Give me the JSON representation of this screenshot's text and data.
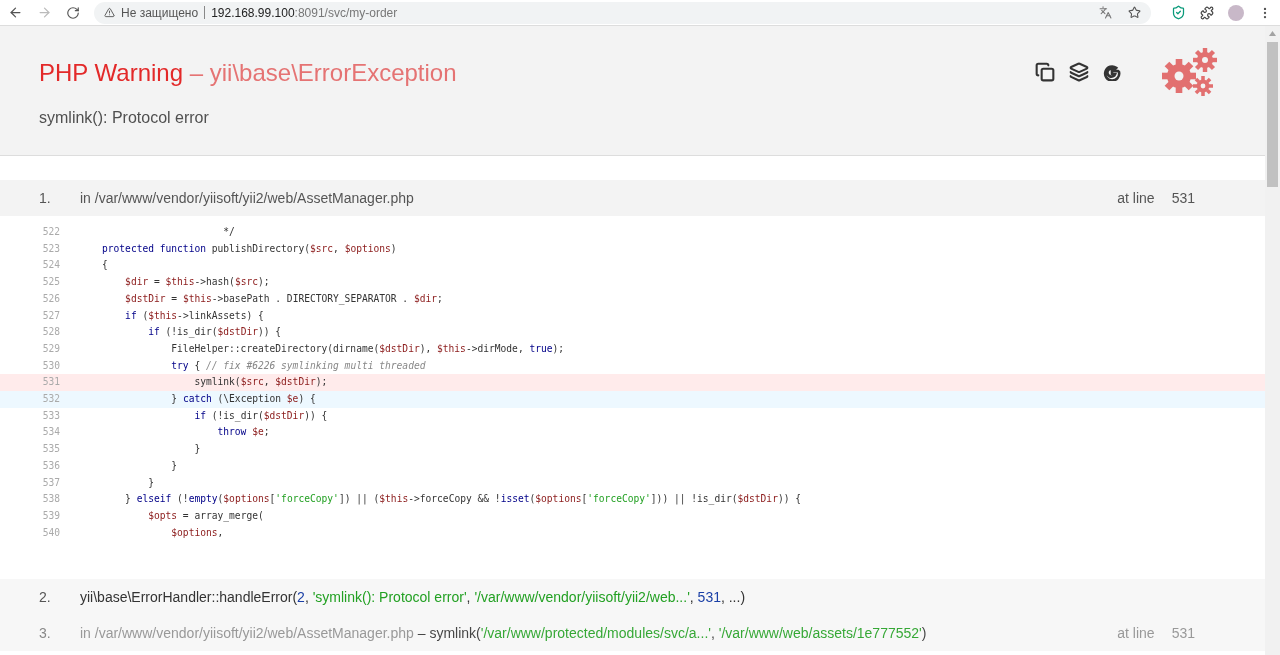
{
  "browser": {
    "security_label": "Не защищено",
    "url_host": "192.168.99.100",
    "url_rest": ":8091/svc/my-order",
    "forward_disabled": true
  },
  "error": {
    "type": "PHP Warning",
    "separator": " – ",
    "class": "yii\\base\\ErrorException",
    "message": "symlink(): Protocol error"
  },
  "frames": [
    {
      "number": "1.",
      "kind": "file",
      "file": "in /var/www/vendor/yiisoft/yii2/web/AssetManager.php",
      "at_line_label": "at line",
      "line": "531",
      "dimmed": false,
      "code": [
        {
          "number": "522",
          "kind": "normal",
          "tokens": [
            {
              "kind": "plain",
              "text": "                     */"
            }
          ]
        },
        {
          "number": "523",
          "kind": "normal",
          "tokens": [
            {
              "kind": "keyword",
              "text": "protected function "
            },
            {
              "kind": "plain",
              "text": "publishDirectory("
            },
            {
              "kind": "variable",
              "text": "$src"
            },
            {
              "kind": "plain",
              "text": ", "
            },
            {
              "kind": "variable",
              "text": "$options"
            },
            {
              "kind": "plain",
              "text": ")"
            }
          ]
        },
        {
          "number": "524",
          "kind": "normal",
          "tokens": [
            {
              "kind": "plain",
              "text": "{"
            }
          ]
        },
        {
          "number": "525",
          "kind": "normal",
          "tokens": [
            {
              "kind": "variable",
              "text": "    $dir"
            },
            {
              "kind": "plain",
              "text": " = "
            },
            {
              "kind": "variable",
              "text": "$this"
            },
            {
              "kind": "plain",
              "text": "->hash("
            },
            {
              "kind": "variable",
              "text": "$src"
            },
            {
              "kind": "plain",
              "text": ");"
            }
          ]
        },
        {
          "number": "526",
          "kind": "normal",
          "tokens": [
            {
              "kind": "variable",
              "text": "    $dstDir"
            },
            {
              "kind": "plain",
              "text": " = "
            },
            {
              "kind": "variable",
              "text": "$this"
            },
            {
              "kind": "plain",
              "text": "->basePath . DIRECTORY_SEPARATOR . "
            },
            {
              "kind": "variable",
              "text": "$dir"
            },
            {
              "kind": "plain",
              "text": ";"
            }
          ]
        },
        {
          "number": "527",
          "kind": "normal",
          "tokens": [
            {
              "kind": "keyword",
              "text": "    if "
            },
            {
              "kind": "plain",
              "text": "("
            },
            {
              "kind": "variable",
              "text": "$this"
            },
            {
              "kind": "plain",
              "text": "->linkAssets) {"
            }
          ]
        },
        {
          "number": "528",
          "kind": "normal",
          "tokens": [
            {
              "kind": "keyword",
              "text": "        if "
            },
            {
              "kind": "plain",
              "text": "(!is_dir("
            },
            {
              "kind": "variable",
              "text": "$dstDir"
            },
            {
              "kind": "plain",
              "text": ")) {"
            }
          ]
        },
        {
          "number": "529",
          "kind": "normal",
          "tokens": [
            {
              "kind": "plain",
              "text": "            FileHelper::createDirectory(dirname("
            },
            {
              "kind": "variable",
              "text": "$dstDir"
            },
            {
              "kind": "plain",
              "text": "), "
            },
            {
              "kind": "variable",
              "text": "$this"
            },
            {
              "kind": "plain",
              "text": "->dirMode, "
            },
            {
              "kind": "keyword",
              "text": "true"
            },
            {
              "kind": "plain",
              "text": ");"
            }
          ]
        },
        {
          "number": "530",
          "kind": "normal",
          "tokens": [
            {
              "kind": "keyword",
              "text": "            try "
            },
            {
              "kind": "plain",
              "text": "{ "
            },
            {
              "kind": "comment",
              "text": "// fix #6226 symlinking multi threaded"
            }
          ]
        },
        {
          "number": "531",
          "kind": "error",
          "tokens": [
            {
              "kind": "plain",
              "text": "                symlink("
            },
            {
              "kind": "variable",
              "text": "$src"
            },
            {
              "kind": "plain",
              "text": ", "
            },
            {
              "kind": "variable",
              "text": "$dstDir"
            },
            {
              "kind": "plain",
              "text": ");"
            }
          ]
        },
        {
          "number": "532",
          "kind": "hover",
          "tokens": [
            {
              "kind": "plain",
              "text": "            } "
            },
            {
              "kind": "keyword",
              "text": "catch "
            },
            {
              "kind": "plain",
              "text": "(\\Exception "
            },
            {
              "kind": "variable",
              "text": "$e"
            },
            {
              "kind": "plain",
              "text": ") {"
            }
          ]
        },
        {
          "number": "533",
          "kind": "normal",
          "tokens": [
            {
              "kind": "keyword",
              "text": "                if "
            },
            {
              "kind": "plain",
              "text": "(!is_dir("
            },
            {
              "kind": "variable",
              "text": "$dstDir"
            },
            {
              "kind": "plain",
              "text": ")) {"
            }
          ]
        },
        {
          "number": "534",
          "kind": "normal",
          "tokens": [
            {
              "kind": "keyword",
              "text": "                    throw "
            },
            {
              "kind": "variable",
              "text": "$e"
            },
            {
              "kind": "plain",
              "text": ";"
            }
          ]
        },
        {
          "number": "535",
          "kind": "normal",
          "tokens": [
            {
              "kind": "plain",
              "text": "                }"
            }
          ]
        },
        {
          "number": "536",
          "kind": "normal",
          "tokens": [
            {
              "kind": "plain",
              "text": "            }"
            }
          ]
        },
        {
          "number": "537",
          "kind": "normal",
          "tokens": [
            {
              "kind": "plain",
              "text": "        }"
            }
          ]
        },
        {
          "number": "538",
          "kind": "normal",
          "tokens": [
            {
              "kind": "plain",
              "text": "    } "
            },
            {
              "kind": "keyword",
              "text": "elseif "
            },
            {
              "kind": "plain",
              "text": "(!"
            },
            {
              "kind": "keyword",
              "text": "empty"
            },
            {
              "kind": "plain",
              "text": "("
            },
            {
              "kind": "variable",
              "text": "$options"
            },
            {
              "kind": "plain",
              "text": "["
            },
            {
              "kind": "string",
              "text": "'forceCopy'"
            },
            {
              "kind": "plain",
              "text": "]) || ("
            },
            {
              "kind": "variable",
              "text": "$this"
            },
            {
              "kind": "plain",
              "text": "->forceCopy && !"
            },
            {
              "kind": "keyword",
              "text": "isset"
            },
            {
              "kind": "plain",
              "text": "("
            },
            {
              "kind": "variable",
              "text": "$options"
            },
            {
              "kind": "plain",
              "text": "["
            },
            {
              "kind": "string",
              "text": "'forceCopy'"
            },
            {
              "kind": "plain",
              "text": "])) || !is_dir("
            },
            {
              "kind": "variable",
              "text": "$dstDir"
            },
            {
              "kind": "plain",
              "text": ")) {"
            }
          ]
        },
        {
          "number": "539",
          "kind": "normal",
          "tokens": [
            {
              "kind": "variable",
              "text": "        $opts"
            },
            {
              "kind": "plain",
              "text": " = array_merge("
            }
          ]
        },
        {
          "number": "540",
          "kind": "normal",
          "tokens": [
            {
              "kind": "variable",
              "text": "            $options"
            },
            {
              "kind": "plain",
              "text": ","
            }
          ]
        }
      ]
    },
    {
      "number": "2.",
      "kind": "call",
      "dimmed": false,
      "call": [
        {
          "kind": "plain",
          "text": "yii\\base\\ErrorHandler::handleError("
        },
        {
          "kind": "number",
          "text": "2"
        },
        {
          "kind": "plain",
          "text": ", "
        },
        {
          "kind": "string",
          "text": "'symlink(): Protocol error'"
        },
        {
          "kind": "plain",
          "text": ", "
        },
        {
          "kind": "string",
          "text": "'/var/www/vendor/yiisoft/yii2/web...'"
        },
        {
          "kind": "plain",
          "text": ", "
        },
        {
          "kind": "number",
          "text": "531"
        },
        {
          "kind": "plain",
          "text": ", ...)"
        }
      ]
    },
    {
      "number": "3.",
      "kind": "file",
      "file": "in /var/www/vendor/yiisoft/yii2/web/AssetManager.php",
      "dimmed": true,
      "call": [
        {
          "kind": "plain",
          "text": " – symlink("
        },
        {
          "kind": "string",
          "text": "'/var/www/protected/modules/svc/a...'"
        },
        {
          "kind": "plain",
          "text": ", "
        },
        {
          "kind": "string",
          "text": "'/var/www/web/assets/1e777552'"
        },
        {
          "kind": "plain",
          "text": ")"
        }
      ],
      "at_line_label": "at line",
      "line": "531"
    }
  ]
}
